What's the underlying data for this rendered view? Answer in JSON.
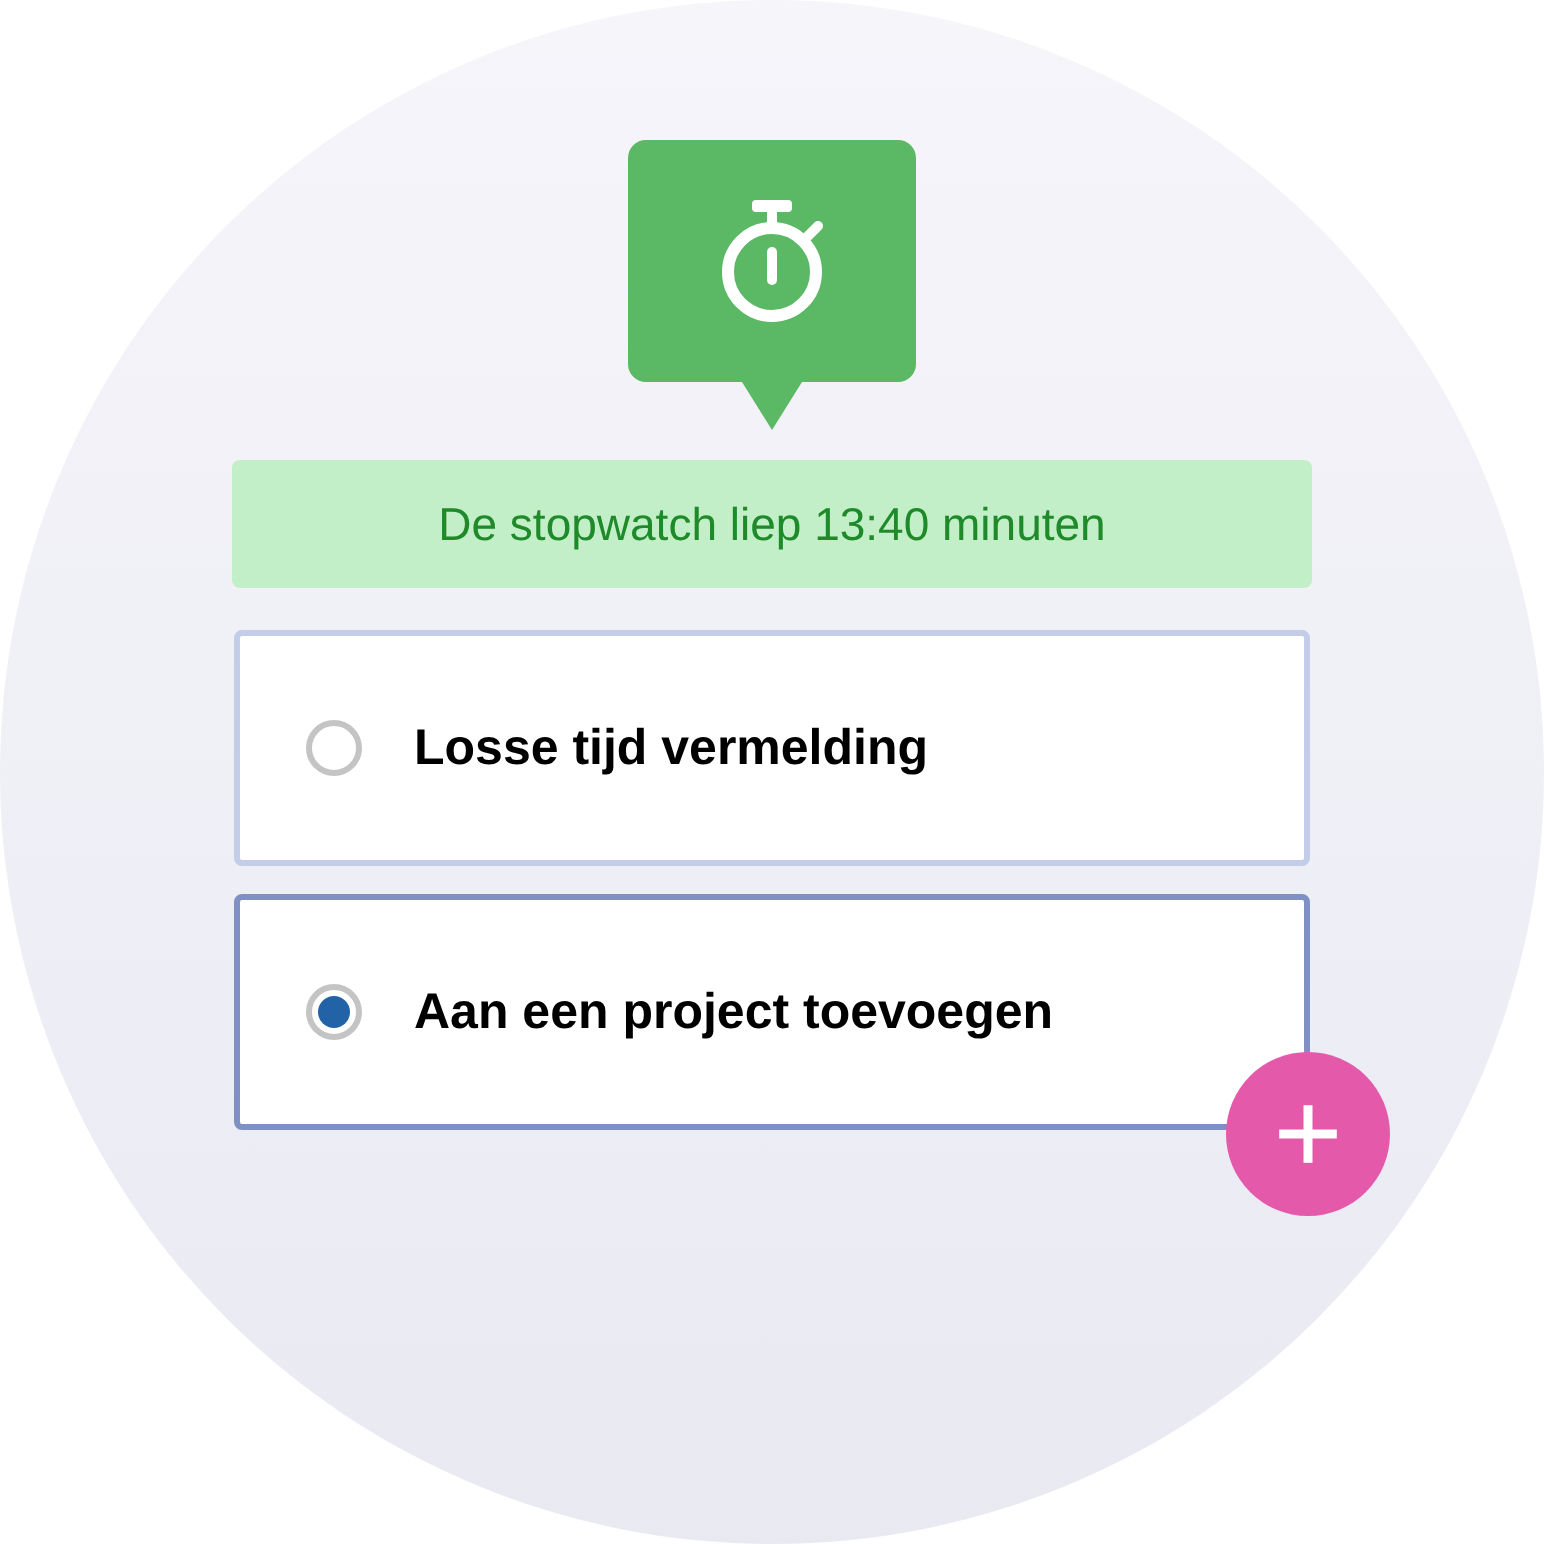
{
  "banner": {
    "text": "De stopwatch liep 13:40 minuten"
  },
  "options": [
    {
      "label": "Losse tijd vermelding",
      "selected": false
    },
    {
      "label": "Aan een project toevoegen",
      "selected": true
    }
  ]
}
